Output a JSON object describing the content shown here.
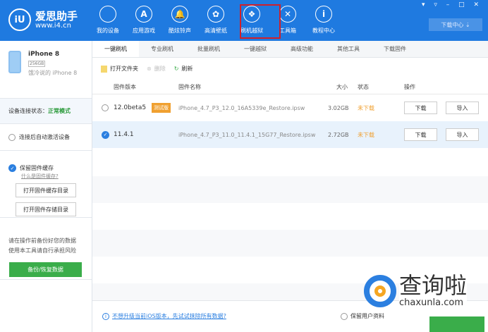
{
  "header": {
    "logo_mark": "iU",
    "app_name": "爱思助手",
    "site": "www.i4.cn",
    "nav": [
      {
        "label": "我的设备",
        "icon": "apple-icon",
        "glyph": ""
      },
      {
        "label": "应用游戏",
        "icon": "app-store-icon",
        "glyph": "A"
      },
      {
        "label": "酷炫铃声",
        "icon": "bell-icon",
        "glyph": "🔔"
      },
      {
        "label": "高清壁纸",
        "icon": "flower-icon",
        "glyph": "✿"
      },
      {
        "label": "刷机越狱",
        "icon": "dropbox-icon",
        "glyph": "❖"
      },
      {
        "label": "工具箱",
        "icon": "tools-icon",
        "glyph": "✕"
      },
      {
        "label": "教程中心",
        "icon": "info-icon",
        "glyph": "i"
      }
    ],
    "window_controls": "▾ ▿ – □ ✕",
    "download_center": "下载中心 ⇣"
  },
  "sidebar": {
    "device_name": "iPhone 8",
    "capacity": "256GB",
    "device_desc": "饿冷说的 iPhone 8",
    "status_label": "设备连接状态：",
    "status_value": "正常模式",
    "auto_activate": "连接后自动激活设备",
    "keep_cache": "保留固件缓存",
    "what_is_cache": "什么是固件缓存?",
    "open_cache_dir": "打开固件缓存目录",
    "open_storage_dir": "打开固件存储目录",
    "warning1": "请在操作前备份好您的数据",
    "warning2": "使用本工具请自行承担风险",
    "backup_button": "备份/恢复数据"
  },
  "tabs": [
    "一键刷机",
    "专业刷机",
    "批量刷机",
    "一键越狱",
    "高级功能",
    "其他工具",
    "下载固件"
  ],
  "toolbar": {
    "open_folder": "打开文件夹",
    "delete": "删除",
    "refresh": "刷新"
  },
  "table": {
    "headers": {
      "version": "固件版本",
      "name": "固件名称",
      "size": "大小",
      "status": "状态",
      "action": "操作"
    },
    "rows": [
      {
        "version": "12.0beta5",
        "tag": "测试版",
        "name": "iPhone_4.7_P3_12.0_16A5339e_Restore.ipsw",
        "size": "3.02GB",
        "status": "未下载",
        "download": "下载",
        "import": "导入",
        "selected": false
      },
      {
        "version": "11.4.1",
        "tag": "",
        "name": "iPhone_4.7_P3_11.0_11.4.1_15G77_Restore.ipsw",
        "size": "2.72GB",
        "status": "未下载",
        "download": "下载",
        "import": "导入",
        "selected": true
      }
    ]
  },
  "footer": {
    "link": "不想升级当前iOS版本，先试试抹除所有数据?",
    "keep_data": "保留用户资料"
  },
  "watermark": {
    "cn": "查询啦",
    "url": "chaxunla.com"
  },
  "colors": {
    "brand": "#1f7ae0",
    "green": "#3aad4a",
    "orange": "#f0a030",
    "highlight": "#d0202a"
  }
}
